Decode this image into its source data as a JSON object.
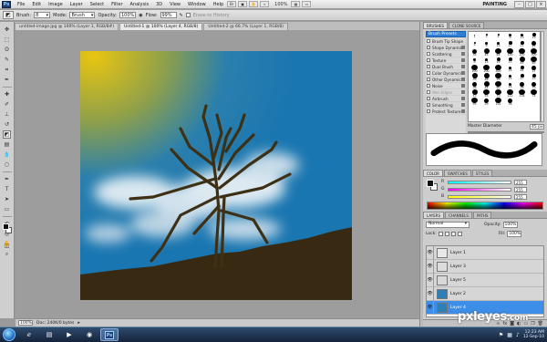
{
  "menubar": {
    "logo": "Ps",
    "items": [
      "File",
      "Edit",
      "Image",
      "Layer",
      "Select",
      "Filter",
      "Analysis",
      "3D",
      "View",
      "Window",
      "Help"
    ],
    "zoom": "100%",
    "workspace": "PAINTING"
  },
  "options": {
    "brush_label": "Brush:",
    "brush_size": "8",
    "mode_label": "Mode:",
    "mode_value": "Brush",
    "opacity_label": "Opacity:",
    "opacity_value": "100%",
    "flow_label": "Flow:",
    "flow_value": "99%",
    "erase_label": "Erase to History"
  },
  "doc_tabs": [
    "untitled-image.jpg @ 100% (Layer 1, RGB/8#)",
    "Untitled-1 @ 100% (Layer 4, RGB/8)",
    "Untitled-2 @ 66.7% (Layer 1, RGB/8)"
  ],
  "statusbar": {
    "zoom": "100%",
    "doc": "Doc: 240K/0 bytes"
  },
  "brushes": {
    "tabs": [
      "BRUSHES",
      "CLONE SOURCE"
    ],
    "presets_button": "Brush Presets",
    "options": [
      {
        "label": "Brush Tip Shape",
        "checked": false,
        "disabled": false
      },
      {
        "label": "Shape Dynamics",
        "checked": false,
        "disabled": false
      },
      {
        "label": "Scattering",
        "checked": false,
        "disabled": false
      },
      {
        "label": "Texture",
        "checked": false,
        "disabled": false
      },
      {
        "label": "Dual Brush",
        "checked": false,
        "disabled": false
      },
      {
        "label": "Color Dynamics",
        "checked": false,
        "disabled": false
      },
      {
        "label": "Other Dynamics",
        "checked": false,
        "disabled": false
      },
      {
        "label": "Noise",
        "checked": false,
        "disabled": false
      },
      {
        "label": "Wet Edges",
        "checked": false,
        "disabled": true
      },
      {
        "label": "Airbrush",
        "checked": false,
        "disabled": false
      },
      {
        "label": "Smoothing",
        "checked": true,
        "disabled": false
      },
      {
        "label": "Protect Texture",
        "checked": false,
        "disabled": false
      }
    ],
    "grid": [
      "1",
      "3",
      "5",
      "9",
      "13",
      "19",
      "5",
      "9",
      "13",
      "17",
      "21",
      "27",
      "35",
      "45",
      "65",
      "100",
      "200",
      "300",
      "9",
      "13",
      "19",
      "17",
      "45",
      "65",
      "100",
      "200",
      "300",
      "14",
      "24",
      "27",
      "39",
      "46",
      "59",
      "11",
      "17",
      "23",
      "36",
      "44",
      "60",
      "14",
      "26",
      "33",
      "42",
      "55",
      "70",
      "112",
      "134",
      "74",
      "95",
      "29",
      "192",
      "36"
    ],
    "master_label": "Master Diameter",
    "master_value": "45 px"
  },
  "color": {
    "tabs": [
      "COLOR",
      "SWATCHES",
      "STYLES"
    ],
    "rows": [
      {
        "label": "R",
        "value": "255"
      },
      {
        "label": "G",
        "value": "255"
      },
      {
        "label": "B",
        "value": "255"
      }
    ]
  },
  "layers": {
    "tabs": [
      "LAYERS",
      "CHANNELS",
      "PATHS"
    ],
    "blend_mode": "Normal",
    "opacity_label": "Opacity:",
    "opacity_value": "100%",
    "lock_label": "Lock:",
    "fill_label": "Fill:",
    "fill_value": "100%",
    "items": [
      {
        "name": "Layer 1",
        "thumb": "#e8e8e8",
        "selected": false
      },
      {
        "name": "Layer 3",
        "thumb": "#dcdcdc",
        "selected": false
      },
      {
        "name": "Layer 5",
        "thumb": "#d8d8d8",
        "selected": false
      },
      {
        "name": "Layer 2",
        "thumb": "#2d7fb6",
        "selected": false
      },
      {
        "name": "Layer 4",
        "thumb": "#2d7fb6",
        "selected": true
      }
    ]
  },
  "taskbar": {
    "time": "12:23 AM",
    "date": "12-Sep-10"
  },
  "watermark": {
    "text": "pxleyes",
    "suffix": ".com"
  },
  "artwork_colors": {
    "sky": "#1a79b2",
    "sun": "#e2c415",
    "ground": "#3a2c12",
    "tree": "#3d2f14"
  }
}
